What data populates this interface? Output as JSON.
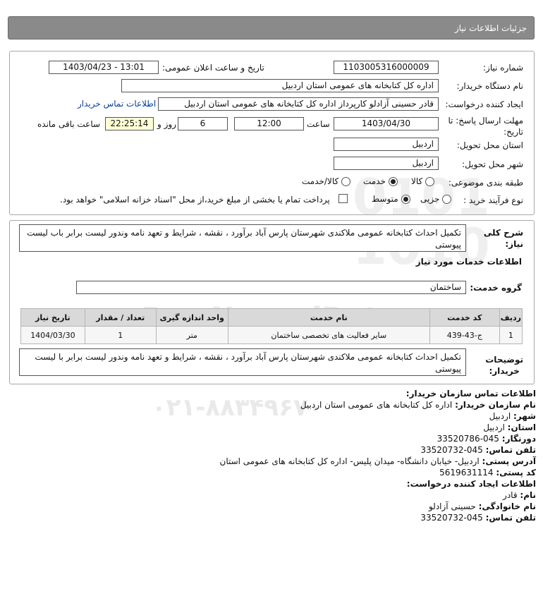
{
  "header": {
    "title": "جزئیات اطلاعات نیاز"
  },
  "need": {
    "number_label": "شماره نیاز:",
    "number": "1103005316000009",
    "announce_label": "تاریخ و ساعت اعلان عمومی:",
    "announce_value": "1403/04/23 - 13:01",
    "buyer_label": "نام دستگاه خریدار:",
    "buyer": "اداره کل کتابخانه های عمومی استان اردبیل",
    "creator_label": "ایجاد کننده درخواست:",
    "creator": "قادر حسینی آزادلو کارپرداز اداره کل کتابخانه های عمومی استان اردبیل",
    "contact_link": "اطلاعات تماس خریدار",
    "deadline_label_1": "مهلت ارسال پاسخ: تا",
    "deadline_label_2": "تاریخ:",
    "deadline_date": "1403/04/30",
    "time_label": "ساعت",
    "deadline_time": "12:00",
    "days": "6",
    "days_label": "روز و",
    "remaining": "22:25:14",
    "remaining_label": "ساعت باقی مانده",
    "province_label": "استان محل تحویل:",
    "province": "اردبیل",
    "city_label": "شهر محل تحویل:",
    "city": "اردبیل",
    "category_label": "طبقه بندی موضوعی:",
    "category_options": [
      "کالا",
      "خدمت",
      "کالا/خدمت"
    ],
    "category_selected": "خدمت",
    "process_label": "نوع فرآیند خرید :",
    "process_options": [
      "جزیی",
      "متوسط"
    ],
    "process_selected": "متوسط",
    "payment_text": "پرداخت تمام یا بخشی از مبلغ خرید،از محل \"اسناد خزانه اسلامی\" خواهد بود."
  },
  "summary": {
    "label_1": "شرح کلی",
    "label_2": "نیاز:",
    "text": "تکمیل احداث کتابخانه عمومی ملاکندی شهرستان پارس آباد برآورد ، نقشه ، شرایط و تعهد نامه وندور لیست برابر باب لیست پیوستی"
  },
  "services": {
    "title": "اطلاعات خدمات مورد نیاز",
    "group_label": "گروه خدمت:",
    "group_value": "ساختمان",
    "columns": [
      "ردیف",
      "کد خدمت",
      "نام خدمت",
      "واحد اندازه گیری",
      "تعداد / مقدار",
      "تاریخ نیاز"
    ],
    "rows": [
      {
        "row": "1",
        "code": "ج-43-439",
        "name": "سایر فعالیت های تخصصی ساختمان",
        "unit": "متر",
        "qty": "1",
        "date": "1404/03/30"
      }
    ]
  },
  "buyer_notes": {
    "label_1": "توضیحات",
    "label_2": "خریدار:",
    "text": "تکمیل احداث کتابخانه عمومی ملاکندی شهرستان پارس آباد برآورد ، نقشه ، شرایط و تعهد نامه وندور لیست برابر با لیست پیوستی"
  },
  "contact": {
    "title": "اطلاعات تماس سازمان خریدار:",
    "org_label": "نام سازمان خریدار:",
    "org": "اداره کل کتابخانه های عمومی استان اردبیل",
    "city_label": "شهر:",
    "city": "اردبیل",
    "province_label": "استان:",
    "province": "اردبیل",
    "fax_label": "دورنگار:",
    "fax": "045-33520786",
    "phone_label": "تلفن تماس:",
    "phone": "045-33520732",
    "address_label": "آدرس پستی:",
    "address": "اردبیل- خیابان دانشگاه- میدان پلیس- اداره کل کتابخانه های عمومی استان",
    "postal_label": "کد پستی:",
    "postal": "5619631114",
    "creator_title": "اطلاعات ایجاد کننده درخواست:",
    "name_label": "نام:",
    "name": "قادر",
    "family_label": "نام خانوادگی:",
    "family": "حسینی آزادلو",
    "creator_phone_label": "تلفن تماس:",
    "creator_phone": "045-33520732"
  },
  "watermark": {
    "brand": "ParsNamadData",
    "tagline": "پایگاه اطلاع رسانی مناقصه ومزایده",
    "phone": "۰۲۱-۸۸۳۴۹۶۷۰"
  },
  "colors": {
    "header_bg": "#8a8a8a",
    "link": "#0a3ea3",
    "remaining_bg": "#ffffd6",
    "table_header": "#d9d9d9"
  }
}
